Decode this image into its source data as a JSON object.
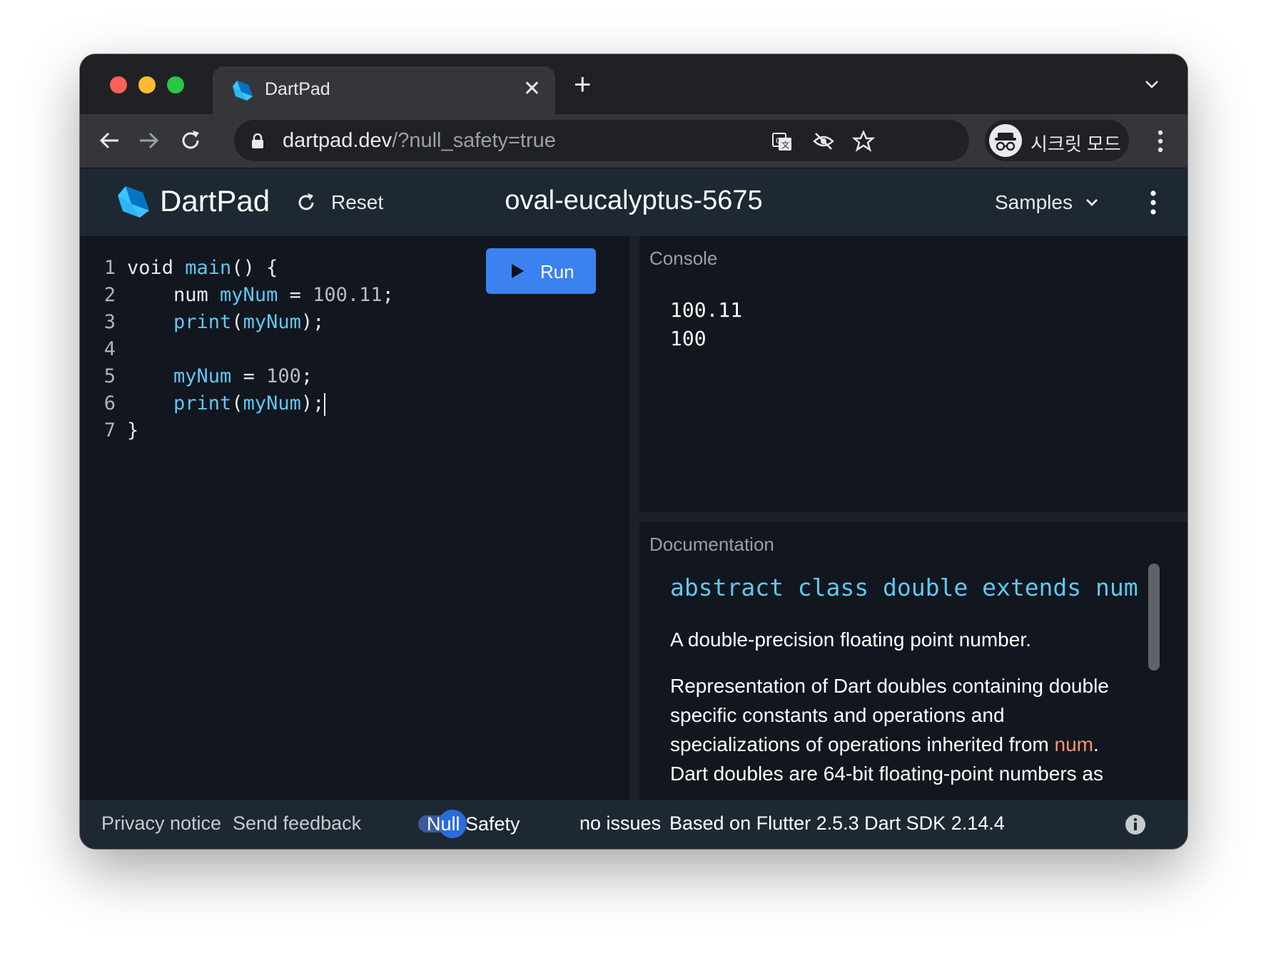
{
  "browser": {
    "tab_title": "DartPad",
    "url_host": "dartpad.dev",
    "url_rest": "/?null_safety=true",
    "profile_label": "시크릿 모드",
    "icons": [
      "lock-icon",
      "translate-icon",
      "eye-off-icon",
      "star-icon",
      "incognito-icon",
      "kebab-menu-icon"
    ]
  },
  "header": {
    "app_name": "DartPad",
    "reset_label": "Reset",
    "snippet_name": "oval-eucalyptus-5675",
    "samples_label": "Samples"
  },
  "editor": {
    "run_label": "Run",
    "lines": [
      {
        "n": "1",
        "tokens": [
          {
            "t": "void ",
            "c": "plain"
          },
          {
            "t": "main",
            "c": "fn"
          },
          {
            "t": "() {",
            "c": "plain"
          }
        ]
      },
      {
        "n": "2",
        "tokens": [
          {
            "t": "    num ",
            "c": "plain"
          },
          {
            "t": "myNum",
            "c": "fn"
          },
          {
            "t": " = ",
            "c": "plain"
          },
          {
            "t": "100.11",
            "c": "num"
          },
          {
            "t": ";",
            "c": "plain"
          }
        ]
      },
      {
        "n": "3",
        "tokens": [
          {
            "t": "    ",
            "c": "plain"
          },
          {
            "t": "print",
            "c": "fn"
          },
          {
            "t": "(",
            "c": "plain"
          },
          {
            "t": "myNum",
            "c": "fn"
          },
          {
            "t": ");",
            "c": "plain"
          }
        ]
      },
      {
        "n": "4",
        "tokens": []
      },
      {
        "n": "5",
        "tokens": [
          {
            "t": "    ",
            "c": "plain"
          },
          {
            "t": "myNum",
            "c": "fn"
          },
          {
            "t": " = ",
            "c": "plain"
          },
          {
            "t": "100",
            "c": "num"
          },
          {
            "t": ";",
            "c": "plain"
          }
        ]
      },
      {
        "n": "6",
        "tokens": [
          {
            "t": "    ",
            "c": "plain"
          },
          {
            "t": "print",
            "c": "fn"
          },
          {
            "t": "(",
            "c": "plain"
          },
          {
            "t": "myNum",
            "c": "fn"
          },
          {
            "t": ");",
            "c": "plain"
          }
        ],
        "caret": true
      },
      {
        "n": "7",
        "tokens": [
          {
            "t": "}",
            "c": "plain"
          }
        ]
      }
    ]
  },
  "console": {
    "title": "Console",
    "output": [
      "100.11",
      "100"
    ]
  },
  "docs": {
    "title": "Documentation",
    "signature": "abstract class double extends num",
    "summary": "A double-precision floating point number.",
    "para_before_link": "Representation of Dart doubles containing double specific constants and operations and specializations of operations inherited from ",
    "para_link": "num",
    "para_after_link": ". Dart doubles are 64-bit floating-point numbers as"
  },
  "footer": {
    "privacy": "Privacy notice",
    "feedback": "Send feedback",
    "null_safety_label": "Null Safety",
    "null_safety_on": true,
    "issues": "no issues",
    "sdk_info": "Based on Flutter 2.5.3 Dart SDK 2.14.4"
  },
  "colors": {
    "accent": "#3b82f0",
    "code_identifier": "#5ec8f2",
    "doc_link": "#f0956a",
    "panel_bg": "#12161e"
  }
}
